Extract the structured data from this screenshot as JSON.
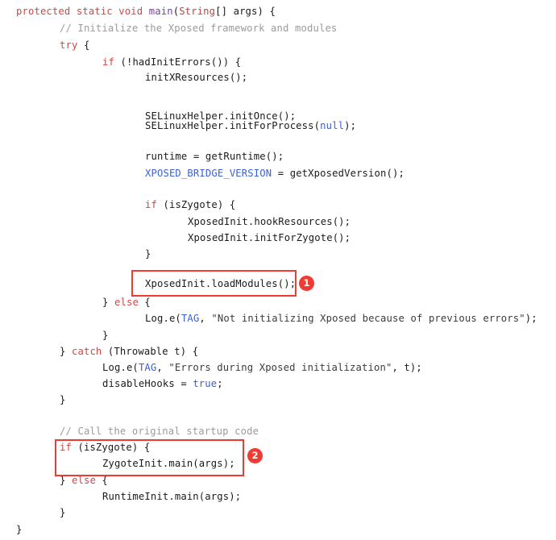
{
  "editor": {
    "language": "java",
    "background_color": "#ffffff",
    "default_text_color": "#1a1a1a",
    "colors": {
      "keyword": "#d14545",
      "type": "#cc3b3b",
      "method_declaration": "#7a3ea8",
      "comment": "#9b9b9b",
      "static_field": "#3b62d6",
      "string_literal": "#3c3c3c",
      "annotation_accent": "#ef3b32"
    }
  },
  "code": {
    "lines": [
      {
        "id": "line-1",
        "text": "protected static void main(String[] args) {"
      },
      {
        "id": "line-2",
        "text": "// Initialize the Xposed framework and modules"
      },
      {
        "id": "line-3",
        "text": "try {"
      },
      {
        "id": "line-4",
        "text": "if (!hadInitErrors()) {"
      },
      {
        "id": "line-5",
        "text": "initXResources();"
      },
      {
        "id": "line-6",
        "text": "SELinuxHelper.initOnce();"
      },
      {
        "id": "line-7",
        "text": "SELinuxHelper.initForProcess(null);"
      },
      {
        "id": "line-8",
        "text": "runtime = getRuntime();"
      },
      {
        "id": "line-9",
        "text": "XPOSED_BRIDGE_VERSION = getXposedVersion();"
      },
      {
        "id": "line-10",
        "text": "if (isZygote) {"
      },
      {
        "id": "line-11",
        "text": "XposedInit.hookResources();"
      },
      {
        "id": "line-12",
        "text": "XposedInit.initForZygote();"
      },
      {
        "id": "line-13",
        "text": "}"
      },
      {
        "id": "line-14",
        "text": "XposedInit.loadModules();"
      },
      {
        "id": "line-15",
        "text": "} else {"
      },
      {
        "id": "line-16",
        "text": "Log.e(TAG, \"Not initializing Xposed because of previous errors\");"
      },
      {
        "id": "line-17",
        "text": "}"
      },
      {
        "id": "line-18",
        "text": "} catch (Throwable t) {"
      },
      {
        "id": "line-19",
        "text": "Log.e(TAG, \"Errors during Xposed initialization\", t);"
      },
      {
        "id": "line-20",
        "text": "disableHooks = true;"
      },
      {
        "id": "line-21",
        "text": "}"
      },
      {
        "id": "line-22",
        "text": "// Call the original startup code"
      },
      {
        "id": "line-23",
        "text": "if (isZygote) {"
      },
      {
        "id": "line-24",
        "text": "ZygoteInit.main(args);"
      },
      {
        "id": "line-25",
        "text": "} else {"
      },
      {
        "id": "line-26",
        "text": "RuntimeInit.main(args);"
      },
      {
        "id": "line-27",
        "text": "}"
      },
      {
        "id": "line-28",
        "text": "}"
      }
    ]
  },
  "annotations": [
    {
      "id": "annotation-1",
      "badge_label": "1",
      "highlights_line": "XposedInit.loadModules();",
      "color": "#ef3b32"
    },
    {
      "id": "annotation-2",
      "badge_label": "2",
      "highlights_line": "if (isZygote) { ZygoteInit.main(args);",
      "color": "#ef3b32"
    }
  ]
}
